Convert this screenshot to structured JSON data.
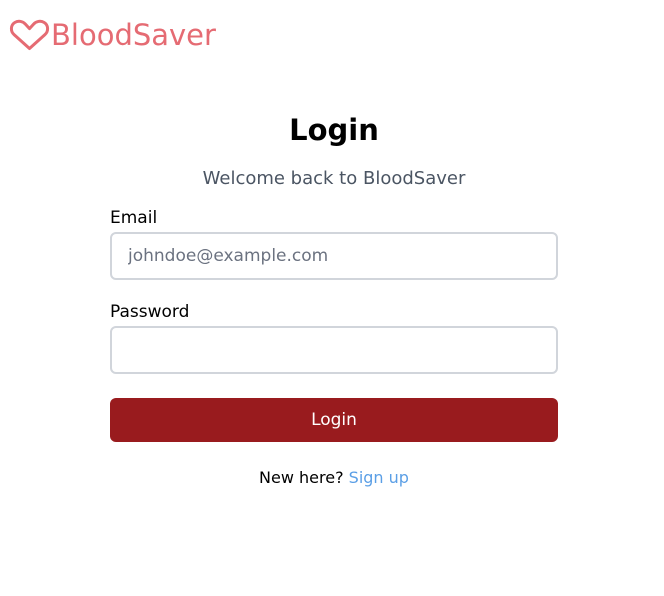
{
  "brand": {
    "name": "BloodSaver",
    "icon": "heart-outline-icon",
    "color": "#e56b73"
  },
  "login": {
    "title": "Login",
    "subtitle": "Welcome back to BloodSaver",
    "email": {
      "label": "Email",
      "placeholder": "johndoe@example.com",
      "value": ""
    },
    "password": {
      "label": "Password",
      "placeholder": "",
      "value": ""
    },
    "submit_label": "Login",
    "submit_color": "#991b1e",
    "signup_prompt": "New here?",
    "signup_link": "Sign up",
    "link_color": "#5b9fe6"
  }
}
